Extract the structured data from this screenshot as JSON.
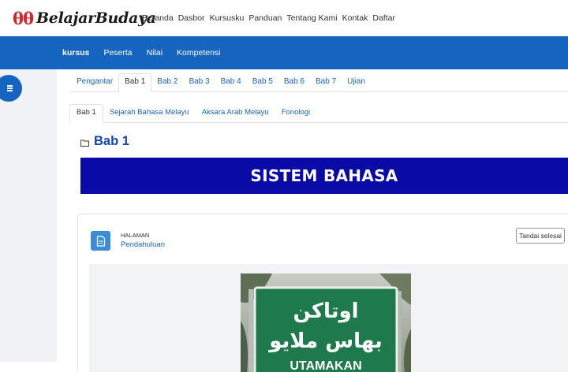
{
  "brand": {
    "mark": "θθ",
    "name": "BelajarBudaya"
  },
  "top_nav": [
    "Beranda",
    "Dasbor",
    "Kursusku",
    "Panduan",
    "Tentang Kami",
    "Kontak",
    "Daftar"
  ],
  "course_nav": {
    "items": [
      "kursus",
      "Peserta",
      "Nilai",
      "Kompetensi"
    ],
    "active": "kursus"
  },
  "section_tabs": {
    "items": [
      "Pengantar",
      "Bab 1",
      "Bab 2",
      "Bab 3",
      "Bab 4",
      "Bab 5",
      "Bab 6",
      "Bab 7",
      "Ujian"
    ],
    "active": "Bab 1"
  },
  "sub_tabs": {
    "items": [
      "Bab 1",
      "Sejarah Bahasa Melayu",
      "Aksara Arab Melayu",
      "Fonologi"
    ],
    "active": "Bab 1"
  },
  "section_title": "Bab 1",
  "banner_text": "SISTEM BAHASA",
  "activity": {
    "type_label": "HALAMAN",
    "name": "Pendahuluan",
    "mark_done_label": "Tandai selesai"
  },
  "sign": {
    "jawi_line1": "اوتاكن",
    "jawi_line2": "بهاس ملايو",
    "latin_line": "UTAMAKAN"
  },
  "colors": {
    "primary": "#1565c0",
    "banner": "#0a0aa6",
    "brand_red": "#d6252e",
    "sign_green": "#1e7a4c"
  }
}
